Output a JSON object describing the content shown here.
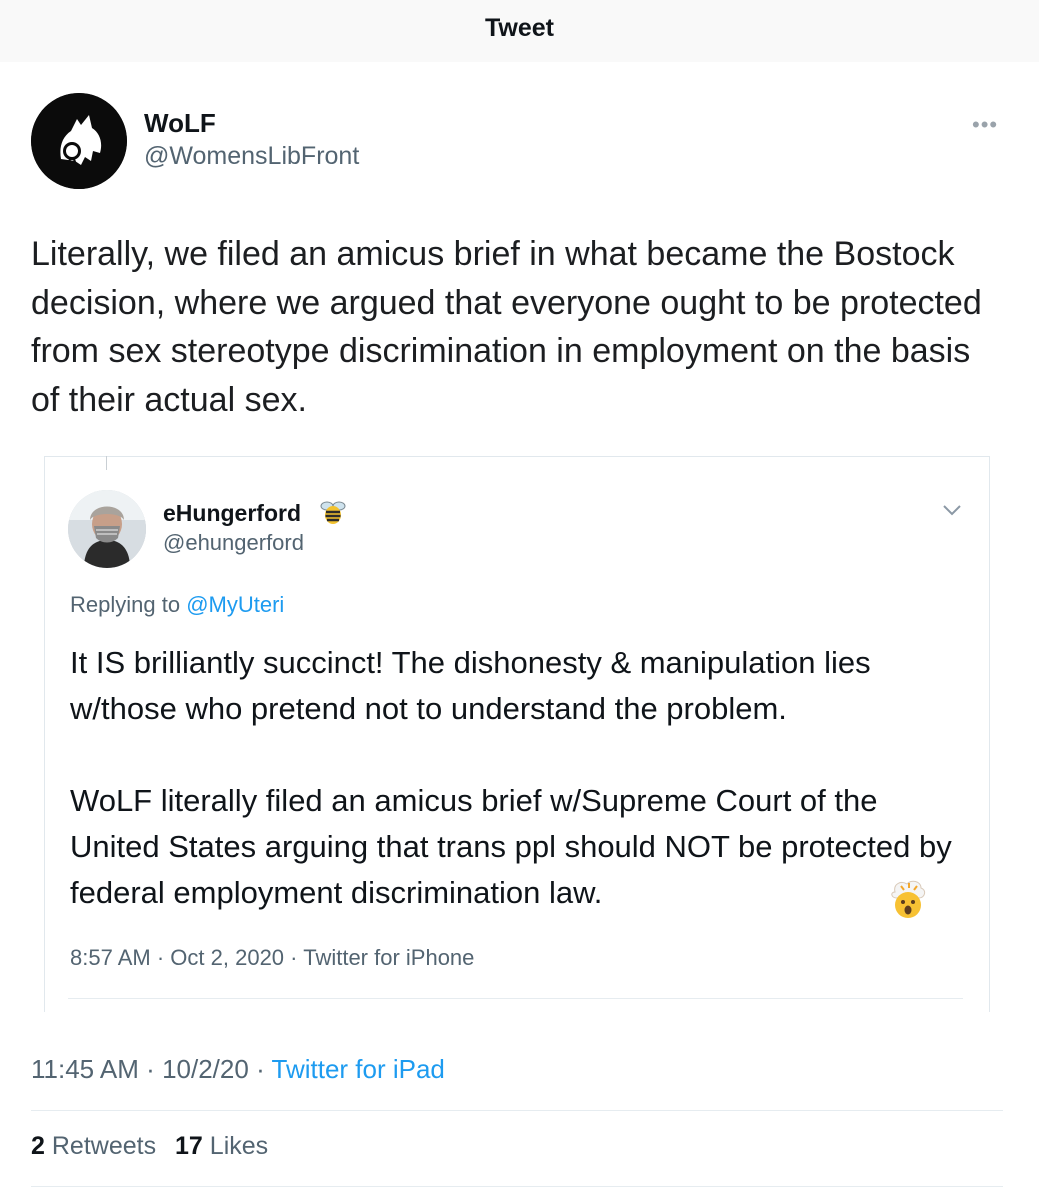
{
  "header": {
    "title": "Tweet"
  },
  "tweet": {
    "author_name": "WoLF",
    "author_handle": "@WomensLibFront",
    "more_label": "•••",
    "text": "Literally, we filed an amicus brief in what became the Bostock decision, where we argued that everyone ought to be protected from sex stereotype discrimination in employment on the basis of their actual sex.",
    "time": "11:45 AM",
    "date": "10/2/20",
    "separator": "·",
    "source": "Twitter for iPad",
    "retweet_count": "2",
    "retweet_label": "Retweets",
    "like_count": "17",
    "like_label": "Likes"
  },
  "quoted": {
    "author_name": "eHungerford",
    "author_handle": "@ehungerford",
    "replying_prefix": "Replying to",
    "replying_to": "@MyUteri",
    "text": "It IS brilliantly succinct! The dishonesty & manipulation lies w/those who pretend not to understand the problem.\n\nWoLF literally filed an amicus brief w/Supreme Court of the United States arguing that trans ppl should NOT be protected by federal employment discrimination law.",
    "time": "8:57 AM",
    "date": "Oct 2, 2020",
    "separator": "·",
    "source": "Twitter for iPhone"
  },
  "colors": {
    "link": "#1d9bf0",
    "secondary": "#536471",
    "text": "#0f1419"
  },
  "icons": {
    "name_badge": "bee-emoji",
    "end_emoji": "exploding-head-emoji",
    "menu": "chevron-down-icon"
  }
}
